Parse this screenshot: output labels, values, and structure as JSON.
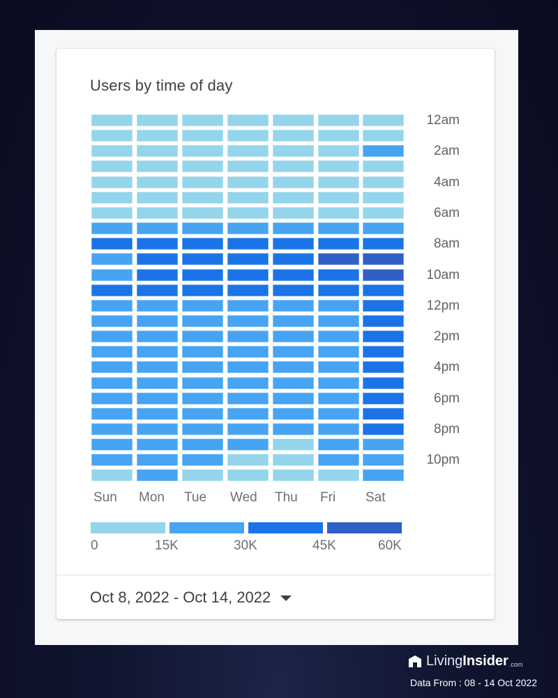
{
  "colors": {
    "levels": [
      "#94d5ec",
      "#46a4f2",
      "#1a74e7",
      "#305fc6"
    ],
    "title_text": "#3c4043",
    "axis_text": "#5f6368"
  },
  "chart_data": {
    "type": "heatmap",
    "title": "Users by time of day",
    "x_categories": [
      "Sun",
      "Mon",
      "Tue",
      "Wed",
      "Thu",
      "Fri",
      "Sat"
    ],
    "y_categories": [
      "12am",
      "1am",
      "2am",
      "3am",
      "4am",
      "5am",
      "6am",
      "7am",
      "8am",
      "9am",
      "10am",
      "11am",
      "12pm",
      "1pm",
      "2pm",
      "3pm",
      "4pm",
      "5pm",
      "6pm",
      "7pm",
      "8pm",
      "9pm",
      "10pm",
      "11pm"
    ],
    "y_tick_labels": [
      "12am",
      "2am",
      "4am",
      "6am",
      "8am",
      "10am",
      "12pm",
      "2pm",
      "4pm",
      "6pm",
      "8pm",
      "10pm"
    ],
    "legend": {
      "ticks": [
        "0",
        "15K",
        "30K",
        "45K",
        "60K"
      ],
      "buckets": [
        {
          "min": 0,
          "max": 15000
        },
        {
          "min": 15000,
          "max": 30000
        },
        {
          "min": 30000,
          "max": 45000
        },
        {
          "min": 45000,
          "max": 60000
        }
      ]
    },
    "value_note": "each cell = bucket index into legend.buckets (0: 0-15K, 1: 15K-30K, 2: 30K-45K, 3: 45K-60K users)",
    "values": [
      [
        0,
        0,
        0,
        0,
        0,
        0,
        0
      ],
      [
        0,
        0,
        0,
        0,
        0,
        0,
        0
      ],
      [
        0,
        0,
        0,
        0,
        0,
        0,
        1
      ],
      [
        0,
        0,
        0,
        0,
        0,
        0,
        0
      ],
      [
        0,
        0,
        0,
        0,
        0,
        0,
        0
      ],
      [
        0,
        0,
        0,
        0,
        0,
        0,
        0
      ],
      [
        0,
        0,
        0,
        0,
        0,
        0,
        0
      ],
      [
        1,
        1,
        1,
        1,
        1,
        1,
        1
      ],
      [
        2,
        2,
        2,
        2,
        2,
        2,
        2
      ],
      [
        1,
        2,
        2,
        2,
        2,
        3,
        3
      ],
      [
        1,
        2,
        2,
        2,
        2,
        2,
        3
      ],
      [
        2,
        2,
        2,
        2,
        2,
        2,
        2
      ],
      [
        1,
        1,
        1,
        1,
        1,
        1,
        2
      ],
      [
        1,
        1,
        1,
        1,
        1,
        1,
        2
      ],
      [
        1,
        1,
        1,
        1,
        1,
        1,
        2
      ],
      [
        1,
        1,
        1,
        1,
        1,
        1,
        2
      ],
      [
        1,
        1,
        1,
        1,
        1,
        1,
        2
      ],
      [
        1,
        1,
        1,
        1,
        1,
        1,
        2
      ],
      [
        1,
        1,
        1,
        1,
        1,
        1,
        2
      ],
      [
        1,
        1,
        1,
        1,
        1,
        1,
        2
      ],
      [
        1,
        1,
        1,
        1,
        1,
        1,
        2
      ],
      [
        1,
        1,
        1,
        1,
        0,
        1,
        1
      ],
      [
        1,
        1,
        1,
        0,
        0,
        1,
        1
      ],
      [
        0,
        1,
        0,
        0,
        0,
        0,
        1
      ]
    ]
  },
  "card": {
    "title": "Users by time of day",
    "date_range": "Oct 8, 2022 - Oct 14, 2022",
    "date_range_icon": "caret-down-icon"
  },
  "branding": {
    "logo_icon": "house-logo-icon",
    "name_light": "Living",
    "name_bold": "Insider",
    "name_suffix": ".com",
    "data_from": "Data From : 08 - 14 Oct 2022"
  }
}
